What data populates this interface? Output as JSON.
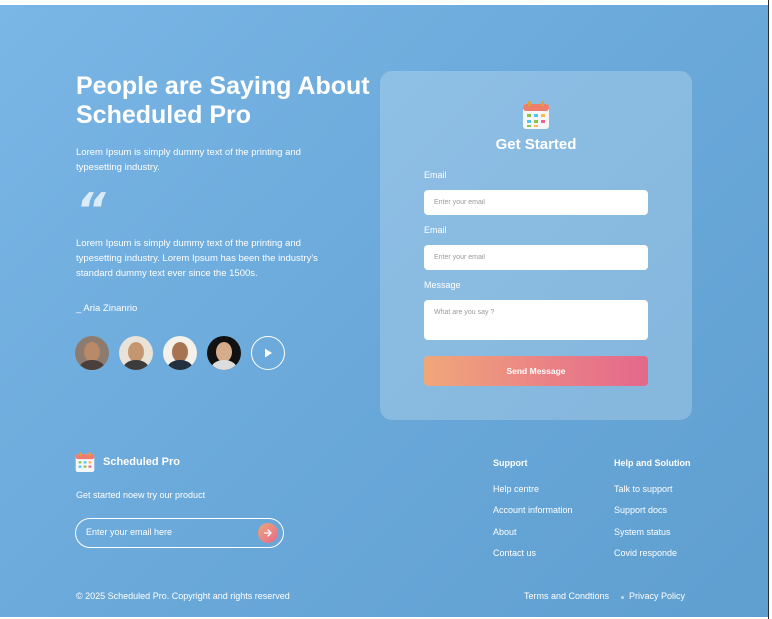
{
  "hero": {
    "title": "People are Saying About Scheduled Pro",
    "subtitle": "Lorem Ipsum is simply dummy text of the printing and typesetting industry.",
    "quote_mark": "“",
    "quote": "Lorem Ipsum is simply dummy text of the printing and typesetting industry. Lorem Ipsum has been the industry's standard dummy text ever since the 1500s.",
    "author": "_ Aria Zinanrio",
    "avatars": [
      "avatar-1",
      "avatar-2",
      "avatar-3",
      "avatar-4"
    ],
    "play_icon": "play-icon"
  },
  "form": {
    "icon": "calendar-icon",
    "title": "Get Started",
    "email_label_1": "Email",
    "email_placeholder_1": "Enter your email",
    "email_label_2": "Email",
    "email_placeholder_2": "Enter your email",
    "message_label": "Message",
    "message_placeholder": "What are you say ?",
    "submit_label": "Send Message"
  },
  "footer": {
    "brand": "Scheduled Pro",
    "tagline": "Get started noew try our product",
    "subscribe_placeholder": "Enter your email here",
    "subscribe_icon": "arrow-right-icon",
    "support": {
      "heading": "Support",
      "links": [
        "Help centre",
        "Account information",
        "About",
        "Contact us"
      ]
    },
    "help": {
      "heading": "Help and Solution",
      "links": [
        "Talk to support",
        "Support docs",
        "System status",
        "Covid responde"
      ]
    },
    "copyright": "© 2025 Scheduled Pro. Copyright and rights reserved",
    "terms": "Terms and Condtions",
    "privacy": "Privacy Policy"
  },
  "colors": {
    "background_start": "#7ab6e6",
    "background_end": "#5f9fd0",
    "button_start": "#f0a77a",
    "button_end": "#e4688c"
  }
}
